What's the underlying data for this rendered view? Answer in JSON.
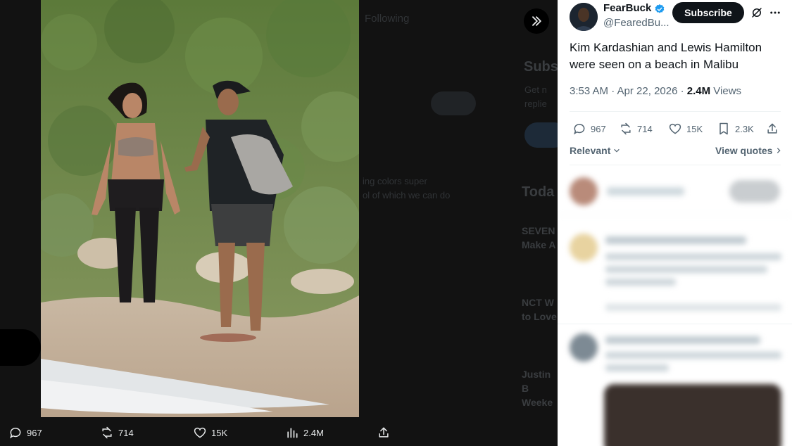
{
  "expand_icon": "chevrons-right-icon",
  "bottom_bar": {
    "replies": "967",
    "reposts": "714",
    "likes": "15K",
    "views": "2.4M"
  },
  "tweet": {
    "author_name": "FearBuck",
    "author_handle": "@FearedBu...",
    "subscribe_label": "Subscribe",
    "text": "Kim Kardashian and Lewis Hamilton were seen on a beach in Malibu",
    "time": "3:53 AM · Apr 22, 2026 · ",
    "views_count": "2.4M",
    "views_label": " Views",
    "replies": "967",
    "reposts": "714",
    "likes": "15K",
    "bookmarks": "2.3K",
    "sort_label": "Relevant",
    "view_quotes_label": "View quotes"
  },
  "colors": {
    "accent": "#1d9bf0",
    "text_primary": "#0f1419",
    "text_secondary": "#536471"
  }
}
